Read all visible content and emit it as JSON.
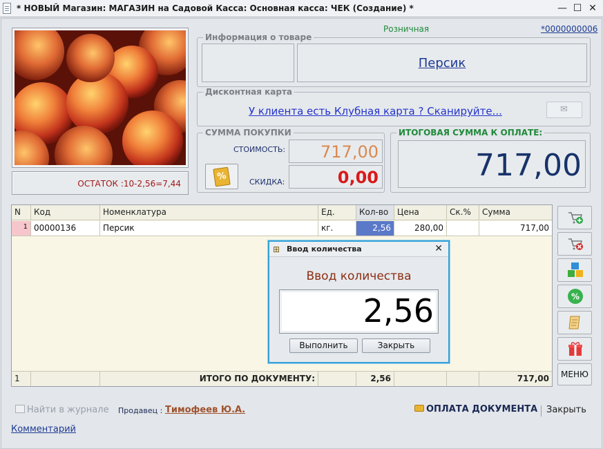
{
  "window": {
    "title": "* НОВЫЙ Магазин: МАГАЗИН на Садовой Касса: Основная касса: ЧЕК (Создание) *",
    "minimize": "—",
    "maximize": "☐",
    "close": "✕"
  },
  "header": {
    "price_type": "Розничная",
    "doc_number": "*0000000006"
  },
  "product_info": {
    "group_title": "Информация о товаре",
    "name": "Персик"
  },
  "stock": {
    "text": "ОСТАТОК :10-2,56=7,44"
  },
  "discount_card": {
    "group_title": "Дисконтная карта",
    "link": "У клиента есть Клубная карта ? Сканируйте...",
    "sms_icon": "envelope-icon"
  },
  "purchase_sum": {
    "group_title": "СУММА ПОКУПКИ",
    "cost_label": "СТОИМОСТЬ:",
    "cost_value": "717,00",
    "discount_label": "СКИДКА:",
    "discount_value": "0,00",
    "discount_button_icon": "%"
  },
  "total": {
    "group_title": "ИТОГОВАЯ СУММА К ОПЛАТЕ:",
    "value": "717,00"
  },
  "table": {
    "headers": [
      "N",
      "Код",
      "Номенклатура",
      "Ед.",
      "Кол-во",
      "Цена",
      "Ск.%",
      "Сумма"
    ],
    "rows": [
      {
        "n": "1",
        "code": "00000136",
        "name": "Персик",
        "unit": "кг.",
        "qty": "2,56",
        "price": "280,00",
        "disc": "",
        "sum": "717,00"
      }
    ],
    "footer": {
      "n": "1",
      "label": "ИТОГО ПО ДОКУМЕНТУ:",
      "qty": "2,56",
      "sum": "717,00"
    }
  },
  "side_buttons": {
    "menu": "МЕНЮ",
    "percent_glyph": "%"
  },
  "dialog": {
    "title": "Ввод количества",
    "heading": "Ввод количества",
    "value": "2,56",
    "ok": "Выполнить",
    "cancel": "Закрыть"
  },
  "footer": {
    "journal": "Найти в журнале",
    "seller_label": "Продавец :",
    "seller_name": "Тимофеев Ю.А.",
    "pay": "ОПЛАТА ДОКУМЕНТА",
    "close": "Закрыть",
    "comment": "Комментарий"
  },
  "colors": {
    "accent_blue": "#35a2d6",
    "total_value": "#17336a",
    "discount_red": "#d81a1a",
    "cost_orange": "#d9894f"
  }
}
